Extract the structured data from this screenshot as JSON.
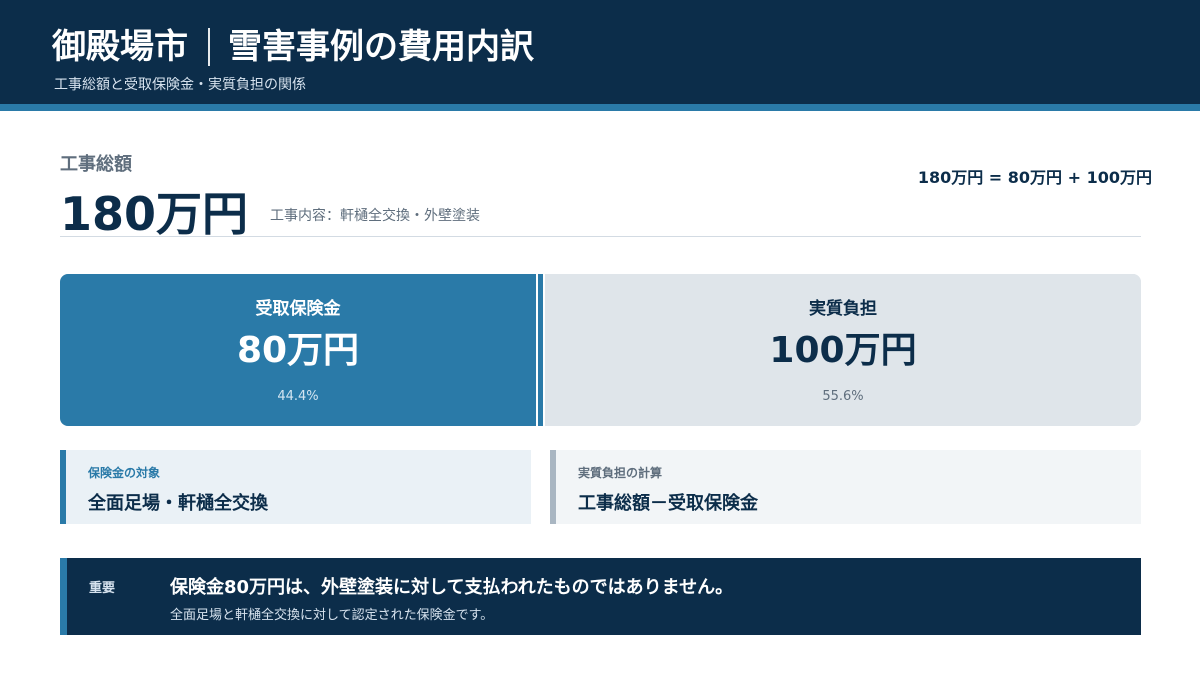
{
  "header": {
    "title_city": "御殿場市",
    "title_topic": "雪害事例の費用内訳",
    "subtitle": "工事総額と受取保険金・実質負担の関係"
  },
  "total": {
    "label": "工事総額",
    "amount": "180万円",
    "detail": "工事内容：軒樋全交換・外壁塗装",
    "equation": "180万円 = 80万円 + 100万円"
  },
  "breakdown": {
    "total_value": 180,
    "insurance": {
      "label": "受取保険金",
      "value_text": "80万円",
      "percent": "44.4%",
      "value": 80
    },
    "own": {
      "label": "実質負担",
      "value_text": "100万円",
      "percent": "55.6%",
      "value": 100
    }
  },
  "cards": {
    "insurance": {
      "label": "保険金の対象",
      "value": "全面足場・軒樋全交換"
    },
    "own": {
      "label": "実質負担の計算",
      "value": "工事総額－受取保険金"
    }
  },
  "note": {
    "tag": "重要",
    "main": "保険金80万円は、外壁塗装に対して支払われたものではありません。",
    "sub": "全面足場と軒樋全交換に対して認定された保険金です。"
  },
  "colors": {
    "navy": "#0c2d4a",
    "accent": "#2a7aa8",
    "light_gray": "#dfe5ea"
  }
}
